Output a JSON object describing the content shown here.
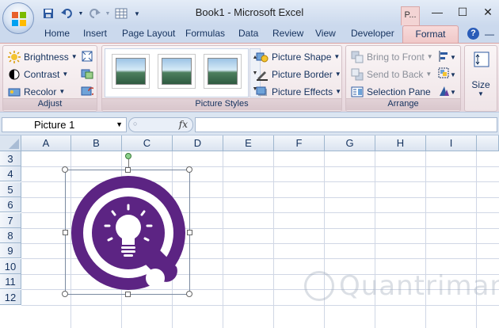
{
  "window": {
    "title": "Book1 - Microsoft Excel",
    "context_tab": "P...",
    "controls": [
      "—",
      "☐",
      "✕"
    ]
  },
  "tabs": [
    "Home",
    "Insert",
    "Page Layout",
    "Formulas",
    "Data",
    "Review",
    "View",
    "Developer"
  ],
  "active_tab": "Format",
  "ribbon": {
    "adjust": {
      "label": "Adjust",
      "brightness": "Brightness",
      "contrast": "Contrast",
      "recolor": "Recolor"
    },
    "picture_styles": {
      "label": "Picture Styles",
      "picture_shape": "Picture Shape",
      "picture_border": "Picture Border",
      "picture_effects": "Picture Effects"
    },
    "arrange": {
      "label": "Arrange",
      "bring_to_front": "Bring to Front",
      "send_to_back": "Send to Back",
      "selection_pane": "Selection Pane"
    },
    "size": {
      "label": "Size"
    }
  },
  "formula_bar": {
    "name_box": "Picture 1",
    "fx": "fx",
    "value": ""
  },
  "grid": {
    "columns": [
      "A",
      "B",
      "C",
      "D",
      "E",
      "F",
      "G",
      "H",
      "I"
    ],
    "rows": [
      "3",
      "4",
      "5",
      "6",
      "7",
      "8",
      "9",
      "10",
      "11",
      "12"
    ]
  },
  "colors": {
    "purple": "#5c2483",
    "ribbon_accent": "#f0c8c8"
  },
  "watermark": "Quantrimang"
}
